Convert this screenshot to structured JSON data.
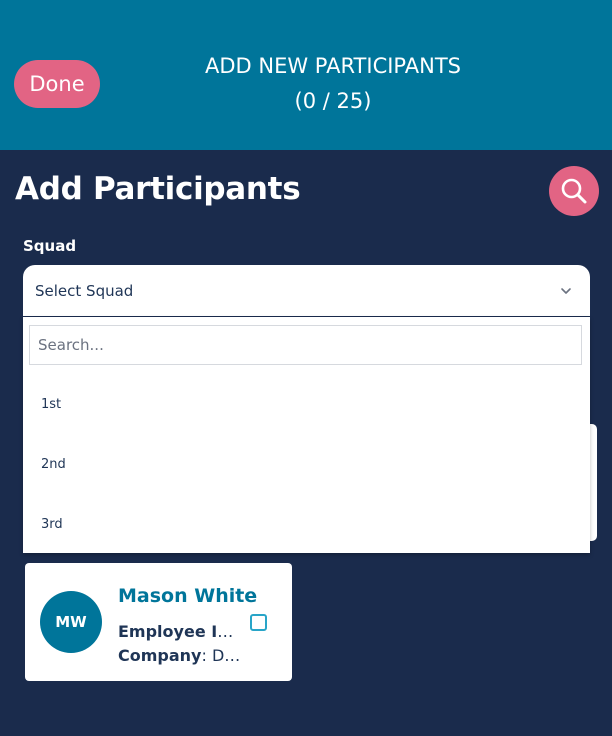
{
  "header": {
    "done_label": "Done",
    "title": "ADD NEW PARTICIPANTS",
    "count": "(0 / 25)"
  },
  "page": {
    "title": "Add Participants",
    "search_icon": "search-icon"
  },
  "squad": {
    "label": "Squad",
    "selected": "Select Squad",
    "search_placeholder": "Search...",
    "options": [
      "1st",
      "2nd",
      "3rd"
    ]
  },
  "participants": [
    {
      "initials": "MW",
      "name": "Mason White",
      "employee_id_label": "Employee ID",
      "employee_id_value": "...",
      "company_label": "Company",
      "company_value": "De..."
    }
  ],
  "colors": {
    "header_bg": "#00759a",
    "page_bg": "#1a2b4c",
    "accent_pink": "#e26484",
    "avatar_teal": "#00759a",
    "checkbox_blue": "#29a5c8"
  }
}
